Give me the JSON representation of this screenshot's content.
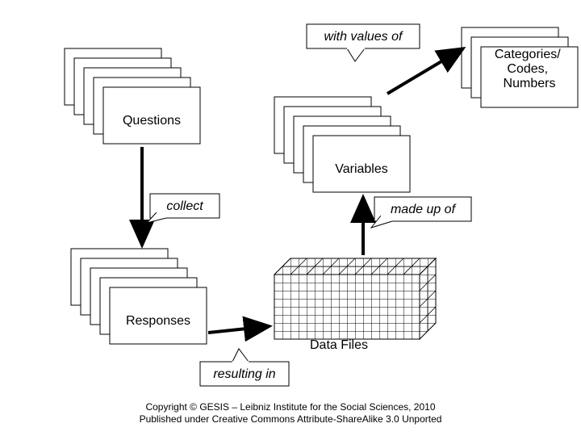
{
  "boxes": {
    "questions": "Questions",
    "responses": "Responses",
    "variables": "Variables",
    "categories": "Categories/ Codes, Numbers",
    "datafiles": "Data Files"
  },
  "labels": {
    "collect": "collect",
    "resulting": "resulting in",
    "madeup": "made up of",
    "withvalues": "with values of"
  },
  "copyright": {
    "line1": "Copyright © GESIS – Leibniz Institute for the Social Sciences, 2010",
    "line2": "Published under Creative Commons Attribute-ShareAlike 3.0 Unported"
  }
}
